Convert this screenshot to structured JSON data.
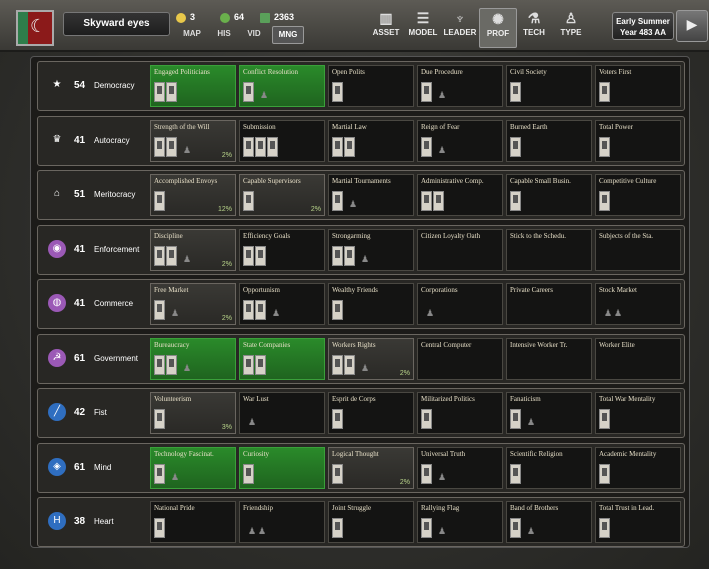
{
  "header": {
    "nation_name": "Skyward eyes",
    "resources": [
      {
        "name": "coin-icon",
        "value": "3",
        "color": "#e8c84a"
      },
      {
        "name": "shield-icon",
        "value": "64",
        "color": "#6ab04c"
      },
      {
        "name": "money-icon",
        "value": "2363",
        "color": "#5aa05a"
      }
    ],
    "menu_tabs": [
      "MAP",
      "HIS",
      "VID",
      "MNG"
    ],
    "active_menu_tab": "MNG",
    "right_tabs": [
      {
        "label": "ASSET",
        "icon": "building-icon",
        "glyph": "▥"
      },
      {
        "label": "MODEL",
        "icon": "grid-icon",
        "glyph": "☰"
      },
      {
        "label": "LEADER",
        "icon": "leader-icon",
        "glyph": "♆"
      },
      {
        "label": "PROF",
        "icon": "prof-icon",
        "glyph": "✺"
      },
      {
        "label": "TECH",
        "icon": "tech-icon",
        "glyph": "⚗"
      },
      {
        "label": "TYPE",
        "icon": "type-icon",
        "glyph": "♙"
      }
    ],
    "active_right_tab": "PROF",
    "date_line1": "Early Summer",
    "date_line2": "Year 483 AA",
    "play_glyph": "▶"
  },
  "rows": [
    {
      "key": "democracy",
      "value": "54",
      "name": "Democracy",
      "icon": "star-icon",
      "glyph": "★",
      "badge_color": "transparent",
      "cells": [
        {
          "label": "Engaged Politicians",
          "state": "active",
          "pct": "",
          "cards": 2,
          "sprites": 0
        },
        {
          "label": "Conflict Resolution",
          "state": "active",
          "pct": "",
          "cards": 1,
          "sprites": 1
        },
        {
          "label": "Open Polits",
          "state": "",
          "pct": "",
          "cards": 1,
          "sprites": 0
        },
        {
          "label": "Due Procedure",
          "state": "",
          "pct": "",
          "cards": 1,
          "sprites": 1
        },
        {
          "label": "Civil Society",
          "state": "",
          "pct": "",
          "cards": 1,
          "sprites": 0
        },
        {
          "label": "Voters First",
          "state": "",
          "pct": "",
          "cards": 1,
          "sprites": 0
        }
      ]
    },
    {
      "key": "autocracy",
      "value": "41",
      "name": "Autocracy",
      "icon": "crown-icon",
      "glyph": "♛",
      "badge_color": "transparent",
      "cells": [
        {
          "label": "Strength of the Will",
          "state": "partial",
          "pct": "2%",
          "cards": 2,
          "sprites": 1
        },
        {
          "label": "Submission",
          "state": "",
          "pct": "",
          "cards": 3,
          "sprites": 0
        },
        {
          "label": "Martial Law",
          "state": "",
          "pct": "",
          "cards": 2,
          "sprites": 0
        },
        {
          "label": "Reign of Fear",
          "state": "",
          "pct": "",
          "cards": 1,
          "sprites": 1
        },
        {
          "label": "Burned Earth",
          "state": "",
          "pct": "",
          "cards": 1,
          "sprites": 0
        },
        {
          "label": "Total Power",
          "state": "",
          "pct": "",
          "cards": 1,
          "sprites": 0
        }
      ]
    },
    {
      "key": "meritocracy",
      "value": "51",
      "name": "Meritocracy",
      "icon": "pillars-icon",
      "glyph": "⌂",
      "badge_color": "transparent",
      "cells": [
        {
          "label": "Accomplished Envoys",
          "state": "partial",
          "pct": "12%",
          "cards": 1,
          "sprites": 0
        },
        {
          "label": "Capable Supervisors",
          "state": "partial",
          "pct": "2%",
          "cards": 1,
          "sprites": 0
        },
        {
          "label": "Martial Tournaments",
          "state": "",
          "pct": "",
          "cards": 1,
          "sprites": 1
        },
        {
          "label": "Administrative Comp.",
          "state": "",
          "pct": "",
          "cards": 2,
          "sprites": 0
        },
        {
          "label": "Capable Small Busin.",
          "state": "",
          "pct": "",
          "cards": 1,
          "sprites": 0
        },
        {
          "label": "Competitive Culture",
          "state": "",
          "pct": "",
          "cards": 1,
          "sprites": 0
        }
      ]
    },
    {
      "key": "enforcement",
      "value": "41",
      "name": "Enforcement",
      "icon": "eye-icon",
      "glyph": "◉",
      "badge_color": "#9b59b6",
      "cells": [
        {
          "label": "Discipline",
          "state": "partial",
          "pct": "2%",
          "cards": 2,
          "sprites": 1
        },
        {
          "label": "Efficiency Goals",
          "state": "",
          "pct": "",
          "cards": 2,
          "sprites": 0
        },
        {
          "label": "Strongarming",
          "state": "",
          "pct": "",
          "cards": 2,
          "sprites": 1
        },
        {
          "label": "Citizen Loyalty Oath",
          "state": "",
          "pct": "",
          "cards": 0,
          "sprites": 0
        },
        {
          "label": "Stick to the Schedu.",
          "state": "",
          "pct": "",
          "cards": 0,
          "sprites": 0
        },
        {
          "label": "Subjects of the Sta.",
          "state": "",
          "pct": "",
          "cards": 0,
          "sprites": 0
        }
      ]
    },
    {
      "key": "commerce",
      "value": "41",
      "name": "Commerce",
      "icon": "coins-icon",
      "glyph": "◍",
      "badge_color": "#9b59b6",
      "cells": [
        {
          "label": "Free Market",
          "state": "partial",
          "pct": "2%",
          "cards": 1,
          "sprites": 1
        },
        {
          "label": "Opportunism",
          "state": "",
          "pct": "",
          "cards": 2,
          "sprites": 1
        },
        {
          "label": "Wealthy Friends",
          "state": "",
          "pct": "",
          "cards": 1,
          "sprites": 0
        },
        {
          "label": "Corporations",
          "state": "",
          "pct": "",
          "cards": 0,
          "sprites": 1
        },
        {
          "label": "Private Careers",
          "state": "",
          "pct": "",
          "cards": 0,
          "sprites": 0
        },
        {
          "label": "Stock Market",
          "state": "",
          "pct": "",
          "cards": 0,
          "sprites": 2
        }
      ]
    },
    {
      "key": "government",
      "value": "61",
      "name": "Government",
      "icon": "hammer-sickle-icon",
      "glyph": "☭",
      "badge_color": "#9b59b6",
      "cells": [
        {
          "label": "Bureaucracy",
          "state": "active",
          "pct": "",
          "cards": 2,
          "sprites": 1
        },
        {
          "label": "State Companies",
          "state": "active",
          "pct": "",
          "cards": 2,
          "sprites": 0
        },
        {
          "label": "Workers Rights",
          "state": "partial",
          "pct": "2%",
          "cards": 2,
          "sprites": 1
        },
        {
          "label": "Central Computer",
          "state": "",
          "pct": "",
          "cards": 0,
          "sprites": 0
        },
        {
          "label": "Intensive Worker Tr.",
          "state": "",
          "pct": "",
          "cards": 0,
          "sprites": 0
        },
        {
          "label": "Worker Elite",
          "state": "",
          "pct": "",
          "cards": 0,
          "sprites": 0
        }
      ]
    },
    {
      "key": "fist",
      "value": "42",
      "name": "Fist",
      "icon": "sword-icon",
      "glyph": "╱",
      "badge_color": "#2f6ec0",
      "cells": [
        {
          "label": "Volunteerism",
          "state": "partial",
          "pct": "3%",
          "cards": 1,
          "sprites": 0
        },
        {
          "label": "War Lust",
          "state": "",
          "pct": "",
          "cards": 0,
          "sprites": 1
        },
        {
          "label": "Esprit de Corps",
          "state": "",
          "pct": "",
          "cards": 1,
          "sprites": 0
        },
        {
          "label": "Militarized Politics",
          "state": "",
          "pct": "",
          "cards": 1,
          "sprites": 0
        },
        {
          "label": "Fanaticism",
          "state": "",
          "pct": "",
          "cards": 1,
          "sprites": 1
        },
        {
          "label": "Total War Mentality",
          "state": "",
          "pct": "",
          "cards": 1,
          "sprites": 0
        }
      ]
    },
    {
      "key": "mind",
      "value": "61",
      "name": "Mind",
      "icon": "graduation-cap-icon",
      "glyph": "◈",
      "badge_color": "#2f6ec0",
      "cells": [
        {
          "label": "Technology Fascinat.",
          "state": "active",
          "pct": "",
          "cards": 1,
          "sprites": 1
        },
        {
          "label": "Curiosity",
          "state": "active",
          "pct": "",
          "cards": 1,
          "sprites": 0
        },
        {
          "label": "Logical Thought",
          "state": "partial",
          "pct": "2%",
          "cards": 1,
          "sprites": 0
        },
        {
          "label": "Universal Truth",
          "state": "",
          "pct": "",
          "cards": 1,
          "sprites": 1
        },
        {
          "label": "Scientific Religion",
          "state": "",
          "pct": "",
          "cards": 1,
          "sprites": 0
        },
        {
          "label": "Academic Mentality",
          "state": "",
          "pct": "",
          "cards": 1,
          "sprites": 0
        }
      ]
    },
    {
      "key": "heart",
      "value": "38",
      "name": "Heart",
      "icon": "heart-h-icon",
      "glyph": "H",
      "badge_color": "#2f6ec0",
      "cells": [
        {
          "label": "National Pride",
          "state": "",
          "pct": "",
          "cards": 1,
          "sprites": 0
        },
        {
          "label": "Friendship",
          "state": "",
          "pct": "",
          "cards": 0,
          "sprites": 2
        },
        {
          "label": "Joint Struggle",
          "state": "",
          "pct": "",
          "cards": 1,
          "sprites": 0
        },
        {
          "label": "Rallying Flag",
          "state": "",
          "pct": "",
          "cards": 1,
          "sprites": 1
        },
        {
          "label": "Band of Brothers",
          "state": "",
          "pct": "",
          "cards": 1,
          "sprites": 1
        },
        {
          "label": "Total Trust in Lead.",
          "state": "",
          "pct": "",
          "cards": 1,
          "sprites": 0
        }
      ]
    }
  ]
}
